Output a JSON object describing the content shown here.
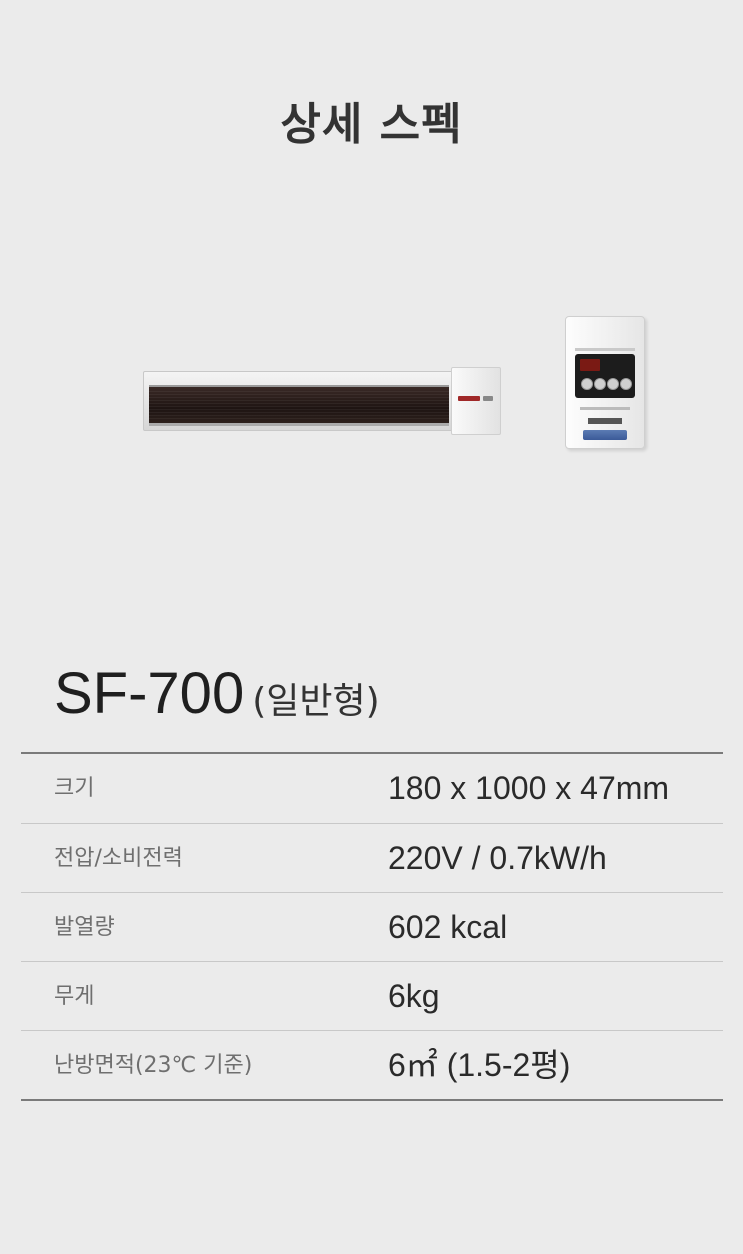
{
  "header": {
    "title": "상세 스펙"
  },
  "product": {
    "model": "SF-700",
    "variant": "(일반형)"
  },
  "specs": [
    {
      "label": "크기",
      "value": "180 x 1000 x 47mm"
    },
    {
      "label": "전압/소비전력",
      "value": "220V / 0.7kW/h"
    },
    {
      "label": "발열량",
      "value": "602 kcal"
    },
    {
      "label": "무게",
      "value": "6kg"
    },
    {
      "label": "난방면적(23℃ 기준)",
      "value": "6㎡ (1.5-2평)"
    }
  ]
}
